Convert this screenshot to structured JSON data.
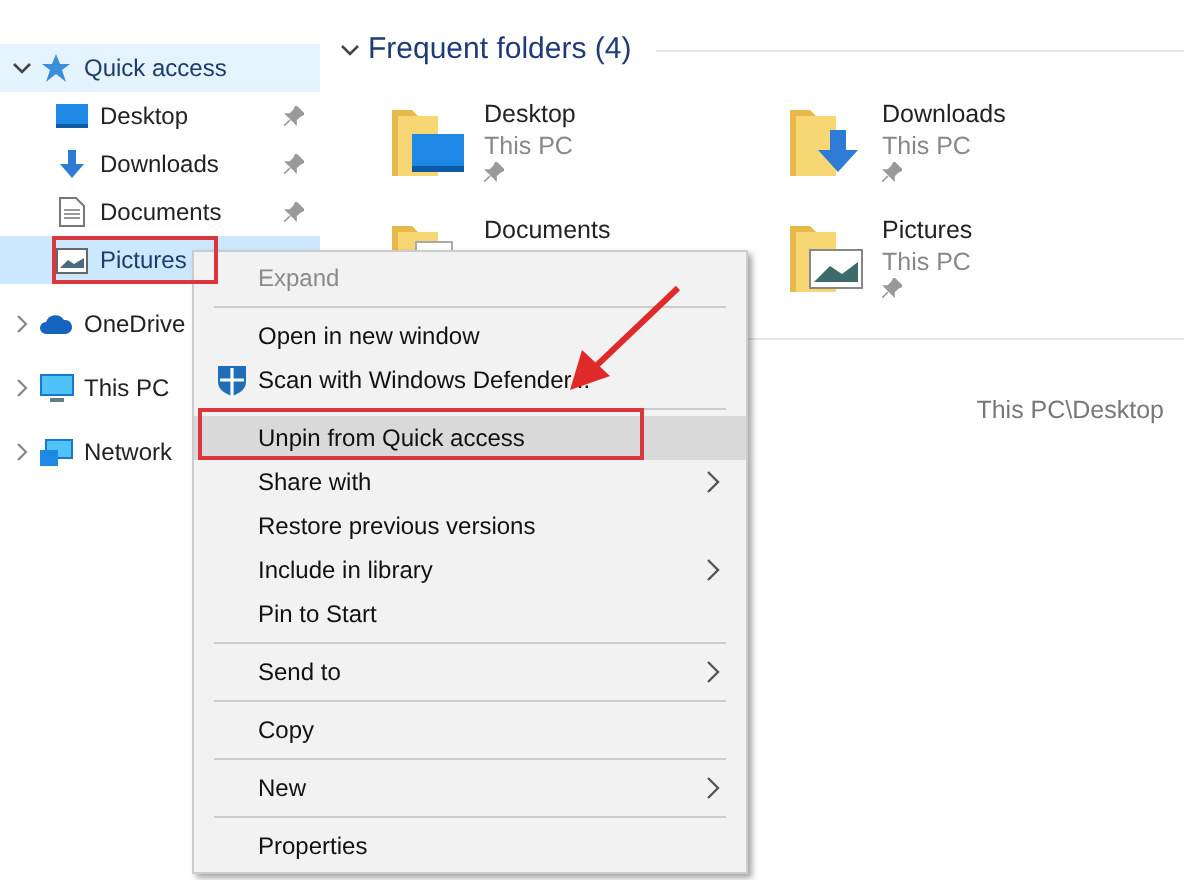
{
  "sidebar": {
    "items": [
      {
        "label": "Quick access",
        "expanded": true,
        "hovered": true,
        "selected": false,
        "children": [
          {
            "label": "Desktop",
            "pinned": true,
            "selected": false
          },
          {
            "label": "Downloads",
            "pinned": true,
            "selected": false
          },
          {
            "label": "Documents",
            "pinned": true,
            "selected": false
          },
          {
            "label": "Pictures",
            "selected": true
          }
        ]
      },
      {
        "label": "OneDrive",
        "expanded": false,
        "hovered": false,
        "selected": false
      },
      {
        "label": "This PC",
        "expanded": false,
        "hovered": false,
        "selected": false
      },
      {
        "label": "Network",
        "expanded": false,
        "hovered": false,
        "selected": false
      }
    ]
  },
  "frequent_folders": {
    "title": "Frequent folders (4)",
    "expanded": true,
    "folders": [
      {
        "name": "Desktop",
        "location": "This PC",
        "pinned": true
      },
      {
        "name": "Downloads",
        "location": "This PC",
        "pinned": true
      },
      {
        "name": "Documents"
      },
      {
        "name": "Pictures",
        "location": "This PC",
        "pinned": true
      }
    ]
  },
  "recent_path": "This PC\\Desktop",
  "context_menu": {
    "items": [
      {
        "kind": "item",
        "label": "Expand",
        "disabled": true,
        "selected": false,
        "submenu": false
      },
      {
        "kind": "separator"
      },
      {
        "kind": "item",
        "label": "Open in new window",
        "disabled": false,
        "selected": false,
        "submenu": false
      },
      {
        "kind": "defender",
        "label": "Scan with Windows Defender...",
        "disabled": false,
        "selected": false,
        "submenu": false
      },
      {
        "kind": "separator"
      },
      {
        "kind": "item",
        "label": "Unpin from Quick access",
        "disabled": false,
        "selected": true,
        "submenu": false
      },
      {
        "kind": "item",
        "label": "Share with",
        "disabled": false,
        "selected": false,
        "submenu": true
      },
      {
        "kind": "item",
        "label": "Restore previous versions",
        "disabled": false,
        "selected": false,
        "submenu": false
      },
      {
        "kind": "item",
        "label": "Include in library",
        "disabled": false,
        "selected": false,
        "submenu": true
      },
      {
        "kind": "item",
        "label": "Pin to Start",
        "disabled": false,
        "selected": false,
        "submenu": false
      },
      {
        "kind": "separator"
      },
      {
        "kind": "item",
        "label": "Send to",
        "disabled": false,
        "selected": false,
        "submenu": true
      },
      {
        "kind": "separator"
      },
      {
        "kind": "item",
        "label": "Copy",
        "disabled": false,
        "selected": false,
        "submenu": false
      },
      {
        "kind": "separator"
      },
      {
        "kind": "item",
        "label": "New",
        "disabled": false,
        "selected": false,
        "submenu": true
      },
      {
        "kind": "separator"
      },
      {
        "kind": "item",
        "label": "Properties",
        "disabled": false,
        "selected": false,
        "submenu": false
      }
    ]
  }
}
